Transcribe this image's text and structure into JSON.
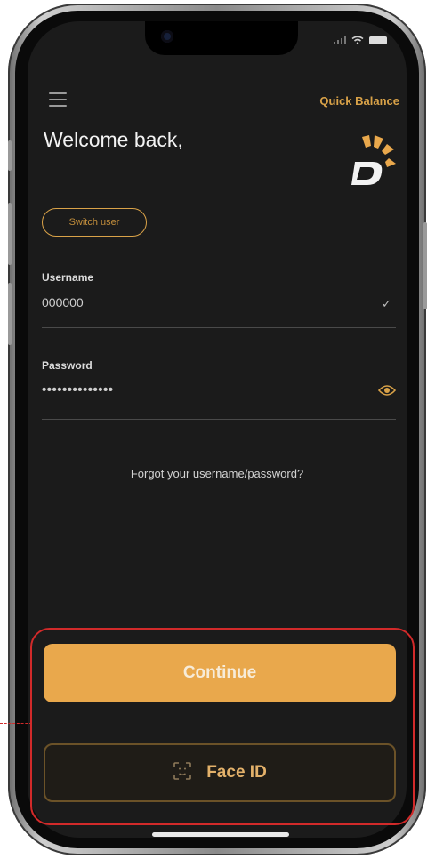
{
  "header": {
    "quick_balance_label": "Quick Balance",
    "welcome_text": "Welcome back,"
  },
  "switch_user": {
    "label": "Switch user"
  },
  "username": {
    "label": "Username",
    "value": "000000"
  },
  "password": {
    "label": "Password",
    "value": "••••••••••••••"
  },
  "forgot_link": {
    "label": "Forgot your username/password?"
  },
  "actions": {
    "continue_label": "Continue",
    "face_id_label": "Face ID"
  },
  "colors": {
    "accent": "#e9a84c",
    "background": "#1b1b1b",
    "highlight": "#d22a2a"
  },
  "icons": [
    "menu-icon",
    "logo-icon",
    "check-icon",
    "eye-icon",
    "face-id-icon"
  ]
}
